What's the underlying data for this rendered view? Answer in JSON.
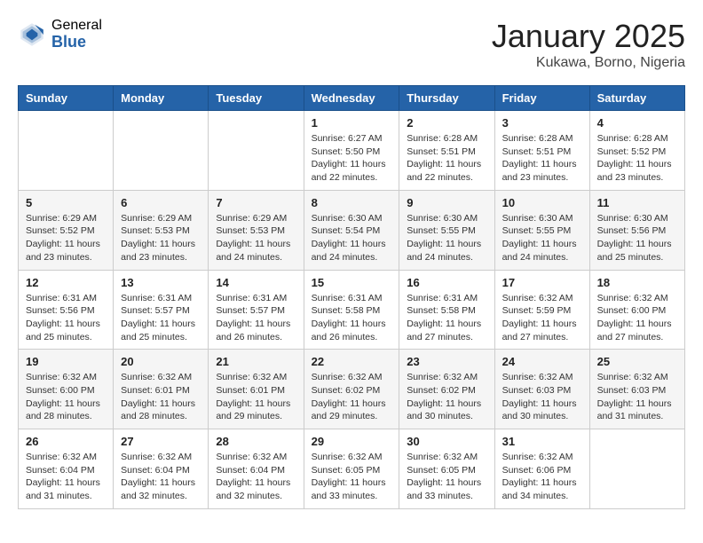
{
  "header": {
    "logo_general": "General",
    "logo_blue": "Blue",
    "month_title": "January 2025",
    "location": "Kukawa, Borno, Nigeria"
  },
  "weekdays": [
    "Sunday",
    "Monday",
    "Tuesday",
    "Wednesday",
    "Thursday",
    "Friday",
    "Saturday"
  ],
  "weeks": [
    [
      {
        "day": "",
        "sunrise": "",
        "sunset": "",
        "daylight": ""
      },
      {
        "day": "",
        "sunrise": "",
        "sunset": "",
        "daylight": ""
      },
      {
        "day": "",
        "sunrise": "",
        "sunset": "",
        "daylight": ""
      },
      {
        "day": "1",
        "sunrise": "Sunrise: 6:27 AM",
        "sunset": "Sunset: 5:50 PM",
        "daylight": "Daylight: 11 hours and 22 minutes."
      },
      {
        "day": "2",
        "sunrise": "Sunrise: 6:28 AM",
        "sunset": "Sunset: 5:51 PM",
        "daylight": "Daylight: 11 hours and 22 minutes."
      },
      {
        "day": "3",
        "sunrise": "Sunrise: 6:28 AM",
        "sunset": "Sunset: 5:51 PM",
        "daylight": "Daylight: 11 hours and 23 minutes."
      },
      {
        "day": "4",
        "sunrise": "Sunrise: 6:28 AM",
        "sunset": "Sunset: 5:52 PM",
        "daylight": "Daylight: 11 hours and 23 minutes."
      }
    ],
    [
      {
        "day": "5",
        "sunrise": "Sunrise: 6:29 AM",
        "sunset": "Sunset: 5:52 PM",
        "daylight": "Daylight: 11 hours and 23 minutes."
      },
      {
        "day": "6",
        "sunrise": "Sunrise: 6:29 AM",
        "sunset": "Sunset: 5:53 PM",
        "daylight": "Daylight: 11 hours and 23 minutes."
      },
      {
        "day": "7",
        "sunrise": "Sunrise: 6:29 AM",
        "sunset": "Sunset: 5:53 PM",
        "daylight": "Daylight: 11 hours and 24 minutes."
      },
      {
        "day": "8",
        "sunrise": "Sunrise: 6:30 AM",
        "sunset": "Sunset: 5:54 PM",
        "daylight": "Daylight: 11 hours and 24 minutes."
      },
      {
        "day": "9",
        "sunrise": "Sunrise: 6:30 AM",
        "sunset": "Sunset: 5:55 PM",
        "daylight": "Daylight: 11 hours and 24 minutes."
      },
      {
        "day": "10",
        "sunrise": "Sunrise: 6:30 AM",
        "sunset": "Sunset: 5:55 PM",
        "daylight": "Daylight: 11 hours and 24 minutes."
      },
      {
        "day": "11",
        "sunrise": "Sunrise: 6:30 AM",
        "sunset": "Sunset: 5:56 PM",
        "daylight": "Daylight: 11 hours and 25 minutes."
      }
    ],
    [
      {
        "day": "12",
        "sunrise": "Sunrise: 6:31 AM",
        "sunset": "Sunset: 5:56 PM",
        "daylight": "Daylight: 11 hours and 25 minutes."
      },
      {
        "day": "13",
        "sunrise": "Sunrise: 6:31 AM",
        "sunset": "Sunset: 5:57 PM",
        "daylight": "Daylight: 11 hours and 25 minutes."
      },
      {
        "day": "14",
        "sunrise": "Sunrise: 6:31 AM",
        "sunset": "Sunset: 5:57 PM",
        "daylight": "Daylight: 11 hours and 26 minutes."
      },
      {
        "day": "15",
        "sunrise": "Sunrise: 6:31 AM",
        "sunset": "Sunset: 5:58 PM",
        "daylight": "Daylight: 11 hours and 26 minutes."
      },
      {
        "day": "16",
        "sunrise": "Sunrise: 6:31 AM",
        "sunset": "Sunset: 5:58 PM",
        "daylight": "Daylight: 11 hours and 27 minutes."
      },
      {
        "day": "17",
        "sunrise": "Sunrise: 6:32 AM",
        "sunset": "Sunset: 5:59 PM",
        "daylight": "Daylight: 11 hours and 27 minutes."
      },
      {
        "day": "18",
        "sunrise": "Sunrise: 6:32 AM",
        "sunset": "Sunset: 6:00 PM",
        "daylight": "Daylight: 11 hours and 27 minutes."
      }
    ],
    [
      {
        "day": "19",
        "sunrise": "Sunrise: 6:32 AM",
        "sunset": "Sunset: 6:00 PM",
        "daylight": "Daylight: 11 hours and 28 minutes."
      },
      {
        "day": "20",
        "sunrise": "Sunrise: 6:32 AM",
        "sunset": "Sunset: 6:01 PM",
        "daylight": "Daylight: 11 hours and 28 minutes."
      },
      {
        "day": "21",
        "sunrise": "Sunrise: 6:32 AM",
        "sunset": "Sunset: 6:01 PM",
        "daylight": "Daylight: 11 hours and 29 minutes."
      },
      {
        "day": "22",
        "sunrise": "Sunrise: 6:32 AM",
        "sunset": "Sunset: 6:02 PM",
        "daylight": "Daylight: 11 hours and 29 minutes."
      },
      {
        "day": "23",
        "sunrise": "Sunrise: 6:32 AM",
        "sunset": "Sunset: 6:02 PM",
        "daylight": "Daylight: 11 hours and 30 minutes."
      },
      {
        "day": "24",
        "sunrise": "Sunrise: 6:32 AM",
        "sunset": "Sunset: 6:03 PM",
        "daylight": "Daylight: 11 hours and 30 minutes."
      },
      {
        "day": "25",
        "sunrise": "Sunrise: 6:32 AM",
        "sunset": "Sunset: 6:03 PM",
        "daylight": "Daylight: 11 hours and 31 minutes."
      }
    ],
    [
      {
        "day": "26",
        "sunrise": "Sunrise: 6:32 AM",
        "sunset": "Sunset: 6:04 PM",
        "daylight": "Daylight: 11 hours and 31 minutes."
      },
      {
        "day": "27",
        "sunrise": "Sunrise: 6:32 AM",
        "sunset": "Sunset: 6:04 PM",
        "daylight": "Daylight: 11 hours and 32 minutes."
      },
      {
        "day": "28",
        "sunrise": "Sunrise: 6:32 AM",
        "sunset": "Sunset: 6:04 PM",
        "daylight": "Daylight: 11 hours and 32 minutes."
      },
      {
        "day": "29",
        "sunrise": "Sunrise: 6:32 AM",
        "sunset": "Sunset: 6:05 PM",
        "daylight": "Daylight: 11 hours and 33 minutes."
      },
      {
        "day": "30",
        "sunrise": "Sunrise: 6:32 AM",
        "sunset": "Sunset: 6:05 PM",
        "daylight": "Daylight: 11 hours and 33 minutes."
      },
      {
        "day": "31",
        "sunrise": "Sunrise: 6:32 AM",
        "sunset": "Sunset: 6:06 PM",
        "daylight": "Daylight: 11 hours and 34 minutes."
      },
      {
        "day": "",
        "sunrise": "",
        "sunset": "",
        "daylight": ""
      }
    ]
  ]
}
